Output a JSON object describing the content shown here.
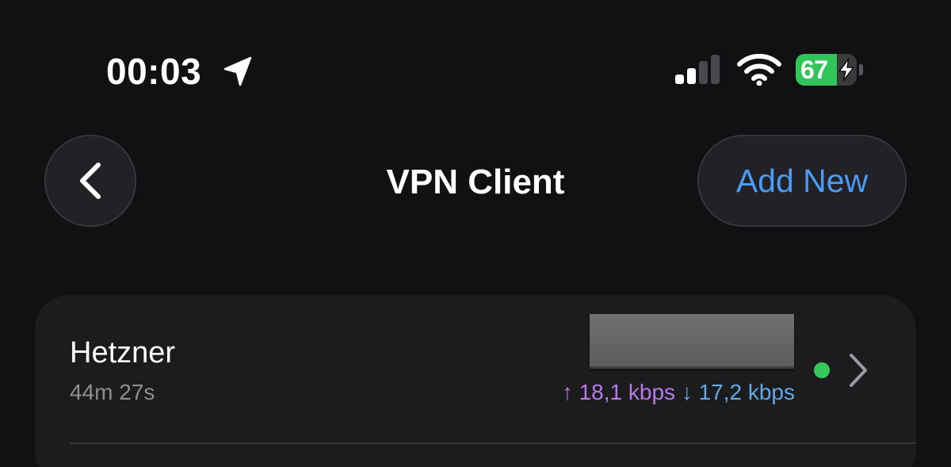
{
  "status_bar": {
    "time": "00:03",
    "location_icon": "location-arrow-icon",
    "signal_icon": "cellular-signal-icon",
    "signal_bars_active": 2,
    "signal_bars_total": 4,
    "wifi_icon": "wifi-icon",
    "battery": {
      "percent": "67",
      "level": 0.67,
      "charging": true,
      "fill_color": "#30c459"
    }
  },
  "nav": {
    "back_icon": "chevron-left-icon",
    "title": "VPN Client",
    "add_new_label": "Add New",
    "accent_color": "#4b9bf5"
  },
  "connections": [
    {
      "name": "Hetzner",
      "duration": "44m 27s",
      "upload": "↑ 18,1 kbps",
      "download": "↓ 17,2 kbps",
      "status": "connected",
      "status_color": "#34c759"
    }
  ]
}
